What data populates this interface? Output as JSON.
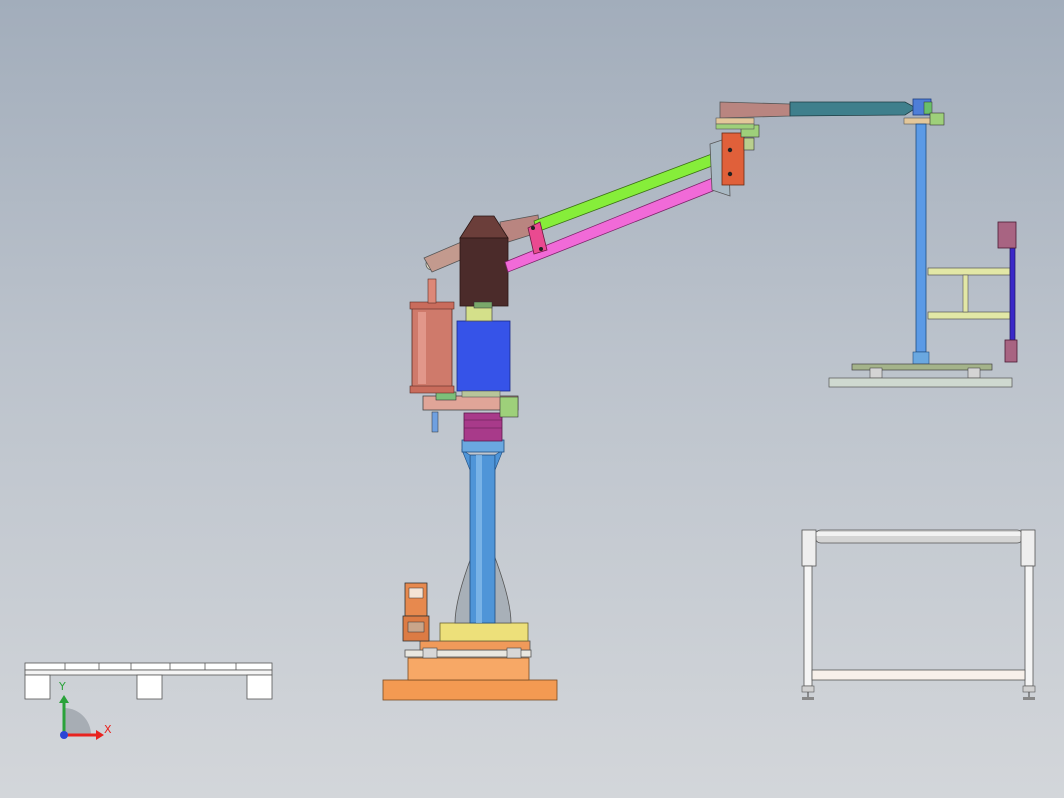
{
  "viewport": {
    "name": "cad-3d-viewport",
    "background_top": "#a2adbb",
    "background_bottom": "#d3d6da"
  },
  "triad": {
    "x_label": "X",
    "y_label": "Y",
    "x_color": "#e8231f",
    "y_color": "#2aa23a",
    "origin_color": "#2b45d6"
  },
  "model": {
    "base_color": "#f39a52",
    "column_color": "#4f95d8",
    "motor_color": "#3653e8",
    "cylinder_color": "#cf7a6b",
    "upper_arm_color": "#86ee3a",
    "lower_arm_color": "#f16ad8",
    "gearbox_color": "#4b2b2a",
    "balance_arm_color": "#b98580",
    "top_arm_color": "#3f7f8c",
    "gripper_color": "#e2e7a6",
    "conveyor_color": "#eeeeee",
    "pallet_color": "#ffffff"
  }
}
